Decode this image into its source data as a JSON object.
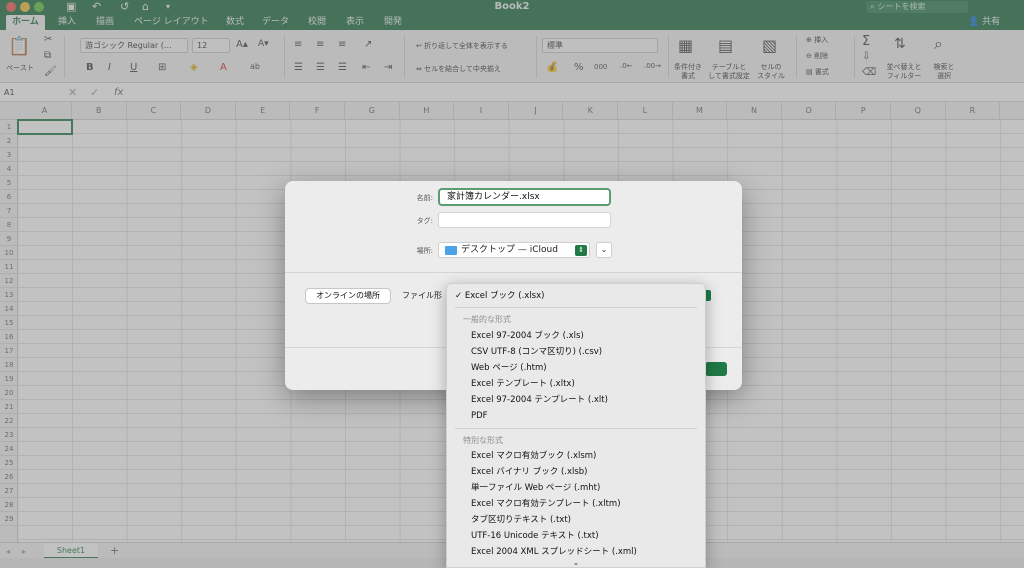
{
  "window": {
    "title": "Book2",
    "search_placeholder": "シートを検索",
    "share_label": "共有"
  },
  "tabs": [
    "ホーム",
    "挿入",
    "描画",
    "ページ レイアウト",
    "数式",
    "データ",
    "校閲",
    "表示",
    "開発"
  ],
  "ribbon": {
    "paste_label": "ペースト",
    "font_name": "游ゴシック Regular (…",
    "font_size": "12",
    "wrap_text": "折り返して全体を表示する",
    "merge_center": "セルを結合して中央揃え",
    "number_format": "標準",
    "cond_format": "条件付き\n書式",
    "format_table": "テーブルと\nして書式設定",
    "cell_styles": "セルの\nスタイル",
    "insert": "挿入",
    "delete": "削除",
    "format": "書式",
    "sort_filter": "並べ替えと\nフィルター",
    "find_select": "検索と\n選択"
  },
  "formula_bar": {
    "name_box": "A1",
    "fx": "fx"
  },
  "grid": {
    "columns": [
      "A",
      "B",
      "C",
      "D",
      "E",
      "F",
      "G",
      "H",
      "I",
      "J",
      "K",
      "L",
      "M",
      "N",
      "O",
      "P",
      "Q",
      "R"
    ],
    "rows": [
      "1",
      "2",
      "3",
      "4",
      "5",
      "6",
      "7",
      "8",
      "9",
      "10",
      "11",
      "12",
      "13",
      "14",
      "15",
      "16",
      "17",
      "18",
      "19",
      "20",
      "21",
      "22",
      "23",
      "24",
      "25",
      "26",
      "27",
      "28",
      "29"
    ]
  },
  "sheet_tab": "Sheet1",
  "dialog": {
    "name_label": "名前:",
    "name_value": "家計簿カレンダー.xlsx",
    "tag_label": "タグ:",
    "location_label": "場所:",
    "location_value": "デスクトップ — iCloud",
    "online_button": "オンラインの場所",
    "format_label": "ファイル形"
  },
  "dropdown": {
    "selected": "Excel ブック (.xlsx)",
    "group1_header": "一般的な形式",
    "group1": [
      "Excel 97-2004 ブック (.xls)",
      "CSV UTF-8 (コンマ区切り) (.csv)",
      "Web ページ (.htm)",
      "Excel テンプレート (.xltx)",
      "Excel 97-2004 テンプレート (.xlt)",
      "PDF"
    ],
    "group2_header": "特別な形式",
    "group2": [
      "Excel マクロ有効ブック (.xlsm)",
      "Excel バイナリ ブック (.xlsb)",
      "単一ファイル Web ページ (.mht)",
      "Excel マクロ有効テンプレート (.xltm)",
      "タブ区切りテキスト (.txt)",
      "UTF-16 Unicode テキスト (.txt)",
      "Excel 2004 XML スプレッドシート (.xml)"
    ]
  },
  "colors": {
    "brand": "#1f6e43",
    "accent": "#1f7a46"
  }
}
